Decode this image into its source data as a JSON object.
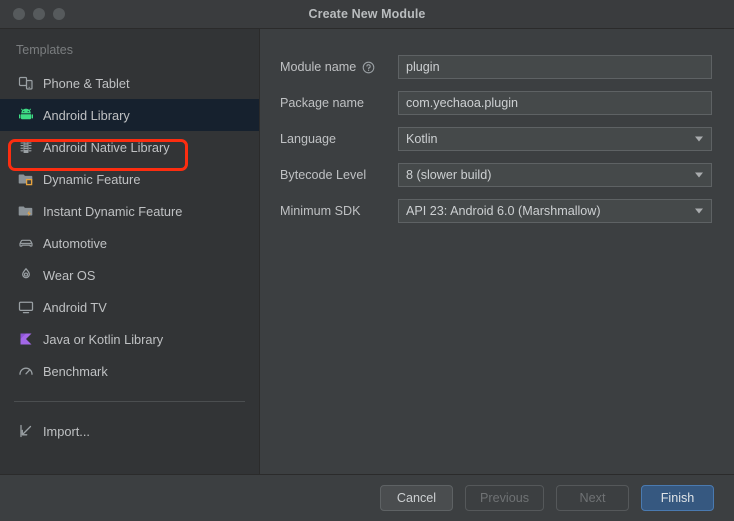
{
  "window": {
    "title": "Create New Module",
    "traffic_lights": [
      "close",
      "minimize",
      "zoom"
    ]
  },
  "sidebar": {
    "section_title": "Templates",
    "selected_index": 1,
    "items": [
      {
        "label": "Phone & Tablet",
        "icon": "phone-tablet-icon"
      },
      {
        "label": "Android Library",
        "icon": "android-robot-icon"
      },
      {
        "label": "Android Native Library",
        "icon": "native-chip-icon"
      },
      {
        "label": "Dynamic Feature",
        "icon": "dynamic-feature-folder-icon"
      },
      {
        "label": "Instant Dynamic Feature",
        "icon": "instant-dynamic-feature-folder-icon"
      },
      {
        "label": "Automotive",
        "icon": "car-icon"
      },
      {
        "label": "Wear OS",
        "icon": "watch-icon"
      },
      {
        "label": "Android TV",
        "icon": "tv-monitor-icon"
      },
      {
        "label": "Java or Kotlin Library",
        "icon": "kotlin-k-icon"
      },
      {
        "label": "Benchmark",
        "icon": "gauge-icon"
      }
    ],
    "import": {
      "label": "Import...",
      "icon": "import-arrow-icon"
    }
  },
  "form": {
    "fields": [
      {
        "label": "Module name",
        "value": "plugin",
        "type": "text",
        "help": true
      },
      {
        "label": "Package name",
        "value": "com.yechaoa.plugin",
        "type": "text",
        "help": false
      },
      {
        "label": "Language",
        "value": "Kotlin",
        "type": "combo",
        "help": false
      },
      {
        "label": "Bytecode Level",
        "value": "8 (slower build)",
        "type": "combo",
        "help": false
      },
      {
        "label": "Minimum SDK",
        "value": "API 23: Android 6.0 (Marshmallow)",
        "type": "combo",
        "help": false
      }
    ]
  },
  "footer": {
    "cancel": "Cancel",
    "previous": "Previous",
    "next": "Next",
    "finish": "Finish"
  },
  "colors": {
    "accent_primary": "#365880",
    "annotation": "#fc2d10",
    "selected_row": "#16212e",
    "android_green": "#3ddc84",
    "kotlin_purple": "#a368e8"
  }
}
